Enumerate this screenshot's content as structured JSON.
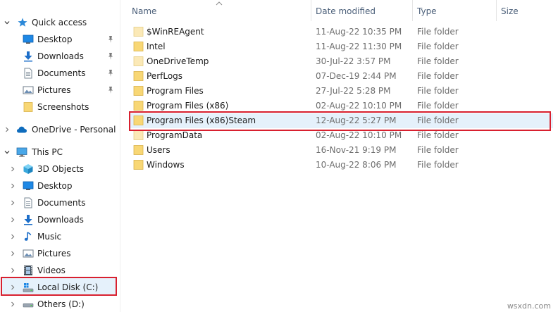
{
  "columns": {
    "name": "Name",
    "date": "Date modified",
    "type": "Type",
    "size": "Size"
  },
  "nav": {
    "quick_access": "Quick access",
    "desktop_qa": "Desktop",
    "downloads_qa": "Downloads",
    "documents_qa": "Documents",
    "pictures_qa": "Pictures",
    "screenshots": "Screenshots",
    "onedrive": "OneDrive - Personal",
    "this_pc": "This PC",
    "objects3d": "3D Objects",
    "desktop": "Desktop",
    "documents": "Documents",
    "downloads": "Downloads",
    "music": "Music",
    "pictures": "Pictures",
    "videos": "Videos",
    "local_disk": "Local Disk (C:)",
    "others": "Others (D:)"
  },
  "files": [
    {
      "name": "$WinREAgent",
      "date": "11-Aug-22 10:35 PM",
      "type": "File folder"
    },
    {
      "name": "Intel",
      "date": "11-Aug-22 11:30 PM",
      "type": "File folder"
    },
    {
      "name": "OneDriveTemp",
      "date": "30-Jul-22 3:57 PM",
      "type": "File folder"
    },
    {
      "name": "PerfLogs",
      "date": "07-Dec-19 2:44 PM",
      "type": "File folder"
    },
    {
      "name": "Program Files",
      "date": "27-Jul-22 5:28 PM",
      "type": "File folder"
    },
    {
      "name": "Program Files (x86)",
      "date": "02-Aug-22 10:10 PM",
      "type": "File folder"
    },
    {
      "name": "Program Files (x86)Steam",
      "date": "12-Aug-22 5:27 PM",
      "type": "File folder"
    },
    {
      "name": "ProgramData",
      "date": "02-Aug-22 10:10 PM",
      "type": "File folder"
    },
    {
      "name": "Users",
      "date": "16-Nov-21 9:19 PM",
      "type": "File folder"
    },
    {
      "name": "Windows",
      "date": "10-Aug-22 8:06 PM",
      "type": "File folder"
    }
  ],
  "watermark": "wsxdn.com",
  "colors": {
    "highlight_border": "#d8202f",
    "selection_bg": "#e5f1fb",
    "folder_yellow": "#f8d775",
    "header_text": "#4c607a"
  }
}
